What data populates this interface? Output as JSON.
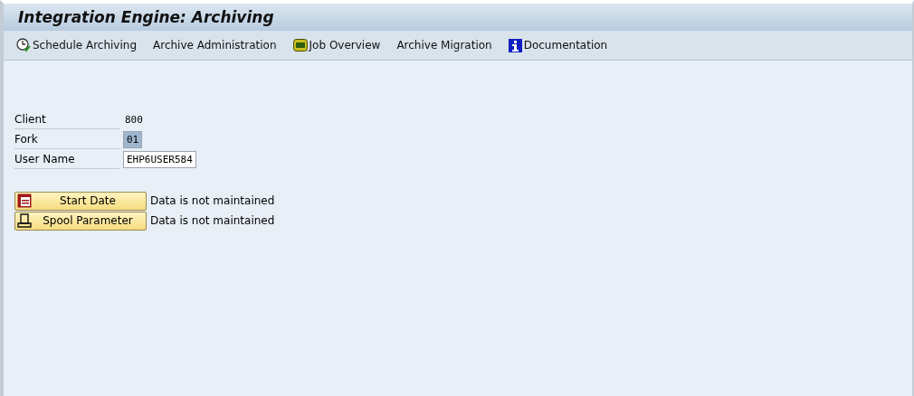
{
  "window": {
    "title": "Integration Engine: Archiving"
  },
  "toolbar": [
    {
      "label": "Schedule Archiving",
      "kind": "clock"
    },
    {
      "label": "Archive Administration",
      "kind": "plain"
    },
    {
      "label": "Job Overview",
      "kind": "job"
    },
    {
      "label": "Archive Migration",
      "kind": "plain"
    },
    {
      "label": "Documentation",
      "kind": "info"
    }
  ],
  "fields": [
    {
      "label": "Client",
      "value": "800",
      "kind": "display",
      "selected": false
    },
    {
      "label": "Fork",
      "value": "01",
      "kind": "input",
      "selected": true
    },
    {
      "label": "User Name",
      "value": "EHP6USER584",
      "kind": "input",
      "selected": false
    }
  ],
  "actions": [
    {
      "label": "Start Date",
      "kind": "calendar",
      "status": "Data is not maintained"
    },
    {
      "label": "Spool Parameter",
      "kind": "printer",
      "status": "Data is not maintained"
    }
  ]
}
